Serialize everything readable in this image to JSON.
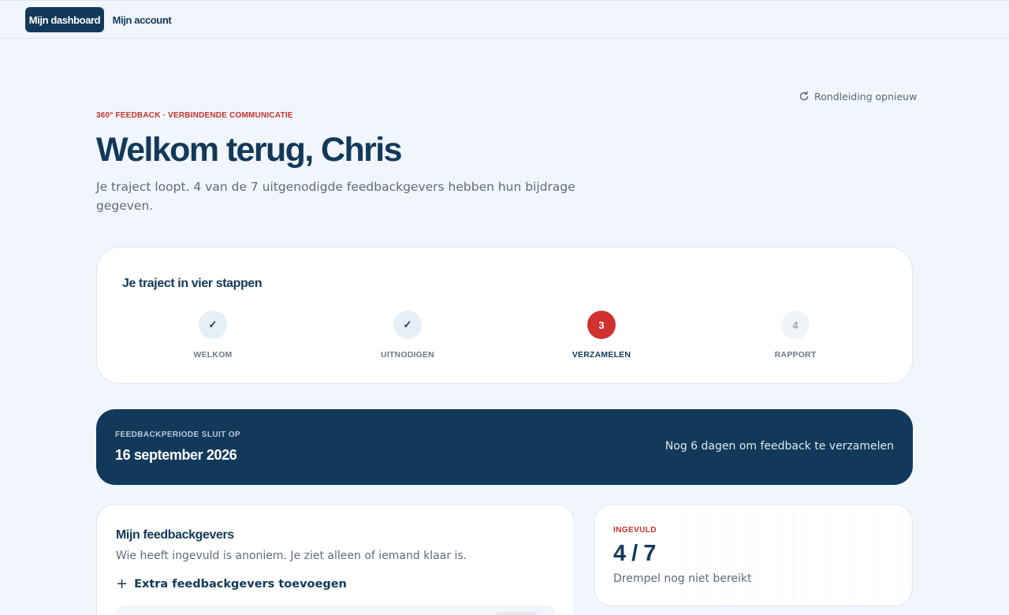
{
  "nav": {
    "dashboard_label": "Mijn dashboard",
    "account_label": "Mijn account"
  },
  "tour": {
    "label": "Rondleiding opnieuw",
    "icon": "refresh-icon"
  },
  "header": {
    "eyebrow": "360° FEEDBACK · VERBINDENDE COMMUNICATIE",
    "title": "Welkom terug, Chris",
    "subtitle": "Je traject loopt. 4 van de 7 uitgenodigde feedbackgevers hebben hun bijdrage gegeven."
  },
  "steps": {
    "title": "Je traject in vier stappen",
    "items": [
      {
        "marker": "✓",
        "label": "WELKOM",
        "state": "done"
      },
      {
        "marker": "✓",
        "label": "UITNODIGEN",
        "state": "done"
      },
      {
        "marker": "3",
        "label": "VERZAMELEN",
        "state": "current"
      },
      {
        "marker": "4",
        "label": "RAPPORT",
        "state": "todo"
      }
    ]
  },
  "deadline": {
    "label": "FEEDBACKPERIODE SLUIT OP",
    "date": "16 september 2026",
    "note": "Nog 6 dagen om feedback te verzamelen"
  },
  "givers": {
    "title": "Mijn feedbackgevers",
    "description": "Wie heeft ingevuld is anoniem. Je ziet alleen of iemand klaar is.",
    "add_icon": "+",
    "add_label": "Extra feedbackgevers toevoegen"
  },
  "completed": {
    "label": "INGEVULD",
    "value": "4 / 7",
    "note": "Drempel nog niet bereikt"
  },
  "colors": {
    "navy": "#12395a",
    "accent_red": "#d0302e",
    "background": "#f1f6fc"
  }
}
